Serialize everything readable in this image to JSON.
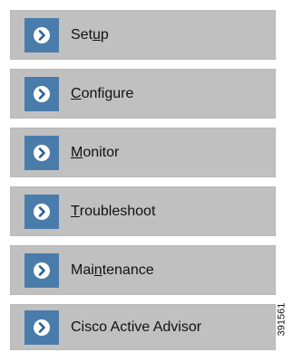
{
  "nav": {
    "items": [
      {
        "id": "setup",
        "label": "Setup",
        "mnemonic_index": 3,
        "icon": "chevron-right-circle-icon"
      },
      {
        "id": "configure",
        "label": "Configure",
        "mnemonic_index": 0,
        "icon": "chevron-right-circle-icon"
      },
      {
        "id": "monitor",
        "label": "Monitor",
        "mnemonic_index": 0,
        "icon": "chevron-right-circle-icon"
      },
      {
        "id": "troubleshoot",
        "label": "Troubleshoot",
        "mnemonic_index": 0,
        "icon": "chevron-right-circle-icon"
      },
      {
        "id": "maintenance",
        "label": "Maintenance",
        "mnemonic_index": 3,
        "icon": "chevron-right-circle-icon"
      },
      {
        "id": "cisco-active-advisor",
        "label": "Cisco Active Advisor",
        "mnemonic_index": -1,
        "icon": "chevron-right-circle-icon"
      }
    ]
  },
  "figure_id": "391561",
  "colors": {
    "item_background": "#c0c0c0",
    "icon_background": "#4a7cab",
    "icon_circle": "#ffffff",
    "icon_chevron": "#2a5f91",
    "text": "#111111"
  }
}
